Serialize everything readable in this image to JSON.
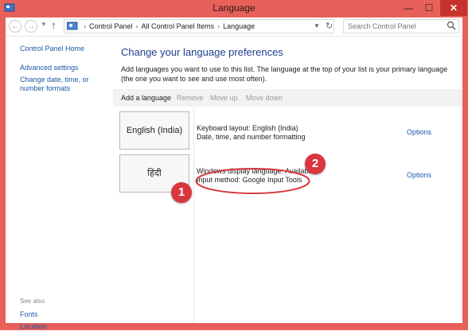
{
  "window": {
    "title": "Language",
    "minimize": "—",
    "maximize": "☐",
    "close": "✕"
  },
  "address_bar": {
    "crumbs": [
      "Control Panel",
      "All Control Panel Items",
      "Language"
    ],
    "search_placeholder": "Search Control Panel"
  },
  "sidebar": {
    "home": "Control Panel Home",
    "advanced": "Advanced settings",
    "change_date": "Change date, time, or number formats",
    "see_also": "See also",
    "fonts": "Fonts",
    "location": "Location"
  },
  "main": {
    "title": "Change your language preferences",
    "description": "Add languages you want to use to this list. The language at the top of your list is your primary language (the one you want to see and use most often)."
  },
  "toolbar": {
    "add": "Add a language",
    "remove": "Remove",
    "move_up": "Move up",
    "move_down": "Move down"
  },
  "languages": [
    {
      "name": "English (India)",
      "line1": "Keyboard layout: English (India)",
      "line2": "Date, time, and number formatting",
      "options": "Options"
    },
    {
      "name": "हिंदी",
      "line1": "Windows display language: Available",
      "line2": "Input method: Google Input Tools",
      "options": "Options"
    }
  ],
  "annotations": {
    "one": "1",
    "two": "2",
    "color": "#d9363e"
  }
}
